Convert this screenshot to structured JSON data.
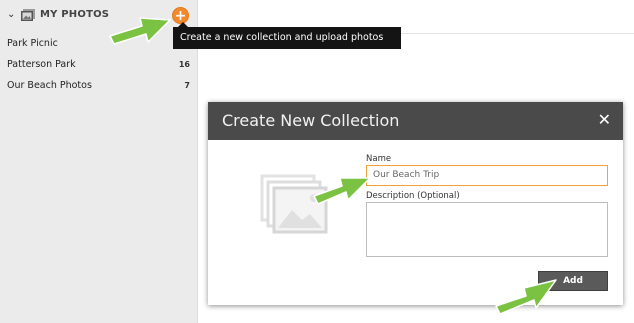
{
  "sidebar": {
    "title": "MY PHOTOS",
    "add_button_glyph": "+",
    "collections": [
      {
        "name": "Park Picnic",
        "count": ""
      },
      {
        "name": "Patterson Park",
        "count": "16"
      },
      {
        "name": "Our Beach Photos",
        "count": "7"
      }
    ]
  },
  "tooltip": {
    "text": "Create a new collection and upload photos"
  },
  "dialog": {
    "title": "Create New Collection",
    "close_glyph": "✕",
    "name_label": "Name",
    "name_value": "Our Beach Trip",
    "description_label": "Description (Optional)",
    "description_value": "",
    "add_label": "Add"
  },
  "icons": {
    "chevron": "chevron-down-icon",
    "photos": "photos-icon",
    "add": "plus-icon",
    "close": "close-icon",
    "placeholder": "image-placeholder-icon",
    "arrow": "pointer-arrow-icon"
  },
  "colors": {
    "accent_orange": "#f28a2d",
    "input_focus_border": "#f0a33c",
    "dialog_header": "#4a4a4a",
    "tooltip_bg": "#141414",
    "sidebar_bg": "#ebebeb",
    "annotation_arrow": "#7cc242"
  }
}
